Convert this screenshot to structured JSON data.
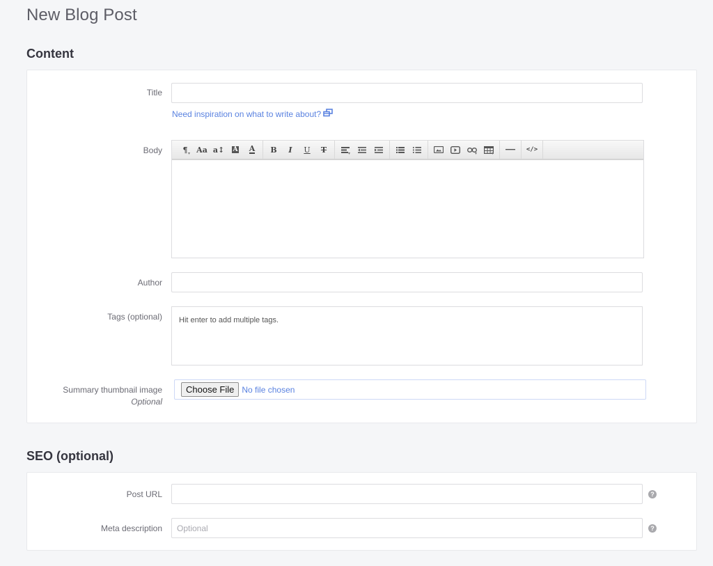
{
  "page": {
    "title": "New Blog Post"
  },
  "content_section": {
    "heading": "Content",
    "title_field": {
      "label": "Title",
      "value": "",
      "placeholder": ""
    },
    "inspiration_link": {
      "label": "Need inspiration on what to write about?",
      "icon": "external-window-icon"
    },
    "body_field": {
      "label": "Body",
      "value": "",
      "toolbar": [
        {
          "group": "style",
          "items": [
            {
              "name": "paragraph-format",
              "icon": "pilcrow-icon",
              "glyph": "¶",
              "dropdown": true
            },
            {
              "name": "font-family",
              "icon": "font-family-icon",
              "glyph": "Aa"
            },
            {
              "name": "font-size",
              "icon": "font-size-icon",
              "glyph": "a↕"
            },
            {
              "name": "background-color",
              "icon": "highlight-icon",
              "glyph": "A"
            },
            {
              "name": "text-color",
              "icon": "text-color-icon",
              "glyph": "A"
            }
          ]
        },
        {
          "group": "format",
          "items": [
            {
              "name": "bold",
              "icon": "bold-icon",
              "glyph": "B"
            },
            {
              "name": "italic",
              "icon": "italic-icon",
              "glyph": "I"
            },
            {
              "name": "underline",
              "icon": "underline-icon",
              "glyph": "U"
            },
            {
              "name": "strikethrough",
              "icon": "strikethrough-icon",
              "glyph": "T"
            }
          ]
        },
        {
          "group": "align",
          "items": [
            {
              "name": "align",
              "icon": "align-left-icon",
              "dropdown": true
            },
            {
              "name": "outdent",
              "icon": "outdent-icon"
            },
            {
              "name": "indent",
              "icon": "indent-icon"
            }
          ]
        },
        {
          "group": "lists",
          "items": [
            {
              "name": "unordered-list",
              "icon": "bullet-list-icon"
            },
            {
              "name": "ordered-list",
              "icon": "numbered-list-icon"
            }
          ]
        },
        {
          "group": "insert",
          "items": [
            {
              "name": "insert-image",
              "icon": "image-icon"
            },
            {
              "name": "insert-video",
              "icon": "video-icon"
            },
            {
              "name": "insert-link",
              "icon": "link-icon",
              "dropdown": true
            },
            {
              "name": "insert-table",
              "icon": "table-icon",
              "dropdown": true
            }
          ]
        },
        {
          "group": "hr",
          "items": [
            {
              "name": "horizontal-rule",
              "icon": "horizontal-rule-icon",
              "glyph": "—"
            }
          ]
        },
        {
          "group": "code",
          "items": [
            {
              "name": "code-view",
              "icon": "code-icon",
              "glyph": "</>"
            }
          ]
        }
      ]
    },
    "author_field": {
      "label": "Author",
      "value": ""
    },
    "tags_field": {
      "label": "Tags (optional)",
      "placeholder": "Hit enter to add multiple tags."
    },
    "thumbnail_field": {
      "label": "Summary thumbnail image",
      "sublabel": "Optional",
      "button_label": "Choose File",
      "status": "No file chosen"
    }
  },
  "seo_section": {
    "heading": "SEO (optional)",
    "post_url_field": {
      "label": "Post URL",
      "value": "",
      "placeholder": "",
      "help_icon": "question-circle-icon",
      "help_glyph": "?"
    },
    "meta_description_field": {
      "label": "Meta description",
      "value": "",
      "placeholder": "Optional",
      "help_icon": "question-circle-icon",
      "help_glyph": "?"
    }
  },
  "colors": {
    "page_background": "#f5f6f8",
    "card_background": "#ffffff",
    "link": "#5a82e0",
    "help_icon": "#a9a9ad"
  }
}
